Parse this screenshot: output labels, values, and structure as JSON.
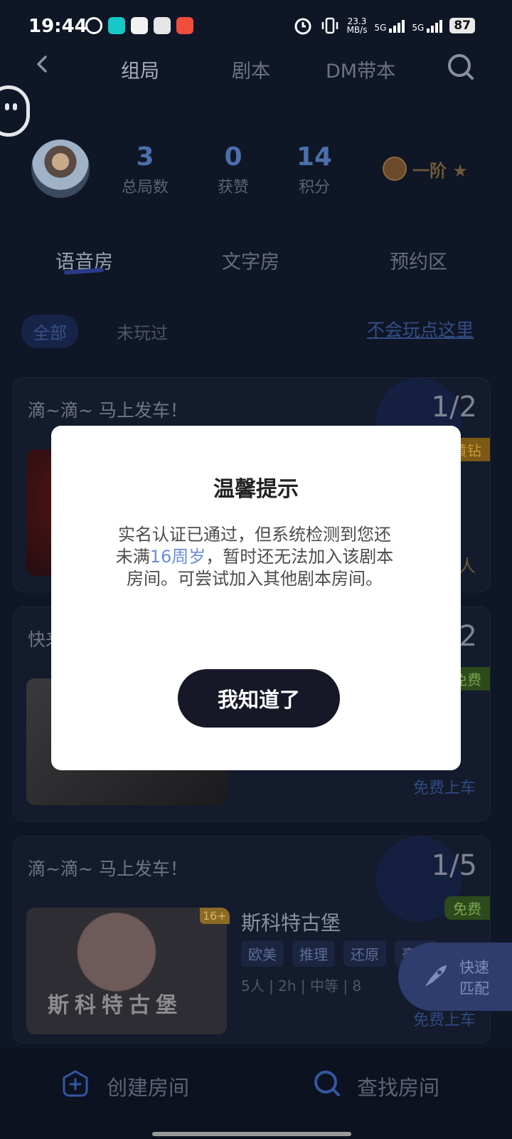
{
  "status_bar": {
    "time": "19:44",
    "net_speed_value": "23.3",
    "net_speed_unit": "MB/s",
    "signal_1": "5G",
    "signal_2": "5G",
    "battery": "87"
  },
  "top_nav": {
    "tabs": [
      "组局",
      "剧本",
      "DM带本"
    ],
    "active_tab": 0
  },
  "profile": {
    "stats": [
      {
        "value": "3",
        "label": "总局数"
      },
      {
        "value": "0",
        "label": "获赞"
      },
      {
        "value": "14",
        "label": "积分"
      }
    ],
    "rank": "一阶 ★"
  },
  "room_tabs": [
    "语音房",
    "文字房",
    "预约区"
  ],
  "filter": {
    "chips": [
      "全部",
      "未玩过"
    ],
    "help_link": "不会玩点这里"
  },
  "cards": [
    {
      "title": "滴~滴~ 马上发车！",
      "count": "1/2",
      "badge": "黄钻",
      "price": "/人"
    },
    {
      "title": "快来",
      "count": "/2",
      "badge": "免费",
      "board": "免费上车"
    },
    {
      "title": "滴~滴~ 马上发车！",
      "count": "1/5",
      "badge": "免费",
      "age": "16+",
      "name": "斯科特古堡",
      "thumb_caption": "斯科特古堡",
      "tags": [
        "欧美",
        "推理",
        "还原",
        "豪门"
      ],
      "meta": "5人 | 2h | 中等 | 8",
      "board": "免费上车"
    }
  ],
  "quick_match": [
    "快速",
    "匹配"
  ],
  "bottom_bar": {
    "create": "创建房间",
    "find": "查找房间"
  },
  "dialog": {
    "title": "温馨提示",
    "msg_part1": "实名认证已通过，但系统检测到您还未满",
    "msg_highlight": "16周岁",
    "msg_part2": "，暂时还无法加入该剧本房间。可尝试加入其他剧本房间。",
    "button": "我知道了"
  },
  "colors": {
    "background": "#0f1626",
    "accent_blue": "#6b8cdb",
    "dialog_button": "#161827",
    "free_green": "#79a451",
    "gold": "#c99a35"
  }
}
